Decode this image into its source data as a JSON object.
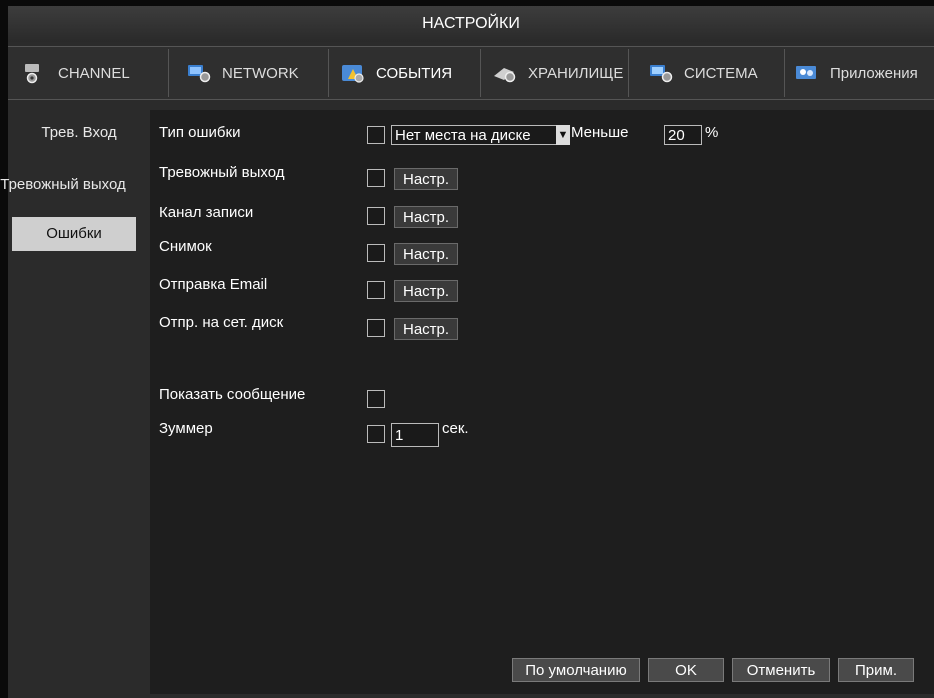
{
  "window": {
    "title": "НАСТРОЙКИ"
  },
  "tabs": [
    {
      "label": "CHANNEL",
      "icon": "camera-gear-icon"
    },
    {
      "label": "NETWORK",
      "icon": "network-gear-icon"
    },
    {
      "label": "СОБЫТИЯ",
      "icon": "events-icon",
      "active": true
    },
    {
      "label": "ХРАНИЛИЩЕ",
      "icon": "storage-icon"
    },
    {
      "label": "СИСТЕМА",
      "icon": "system-gear-icon"
    },
    {
      "label": "Приложения",
      "icon": "apps-icon"
    }
  ],
  "sidebar": {
    "items": [
      {
        "label": "Трев. Вход"
      },
      {
        "label": "Тревожный выход"
      },
      {
        "label": "Ошибки",
        "active": true
      }
    ]
  },
  "form": {
    "error_type": {
      "label": "Тип ошибки",
      "value": "Нет места на диске",
      "less_label": "Меньше",
      "percent_value": "20",
      "percent_unit": "%"
    },
    "alarm_out": {
      "label": "Тревожный выход",
      "button": "Настр."
    },
    "record_channel": {
      "label": "Канал записи",
      "button": "Настр."
    },
    "snapshot": {
      "label": "Снимок",
      "button": "Настр."
    },
    "send_email": {
      "label": "Отправка Email",
      "button": "Настр."
    },
    "send_net_disk": {
      "label": "Отпр. на сет. диск",
      "button": "Настр."
    },
    "show_message": {
      "label": "Показать сообщение"
    },
    "buzzer": {
      "label": "Зуммер",
      "value": "1",
      "unit": "сек."
    }
  },
  "buttons": {
    "default": "По умолчанию",
    "ok": "OK",
    "cancel": "Отменить",
    "apply": "Прим."
  }
}
